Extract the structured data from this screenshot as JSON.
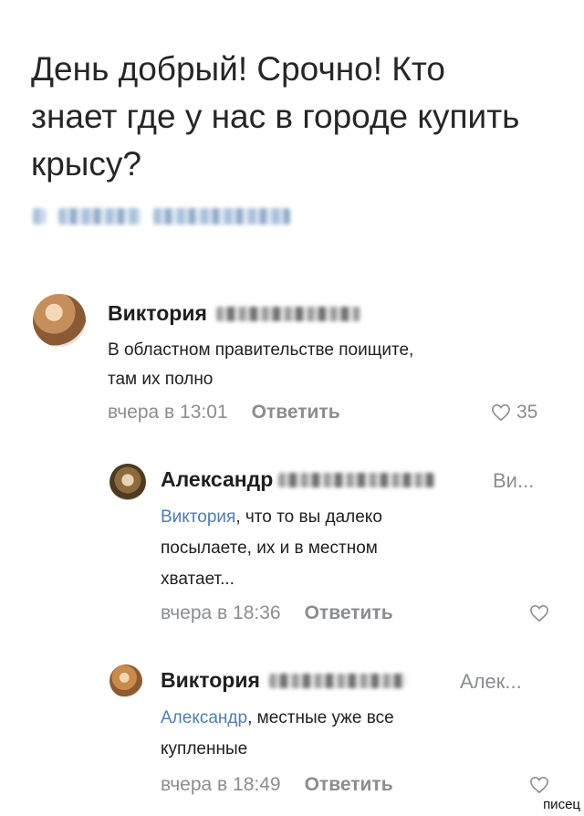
{
  "post": {
    "text_line1": "День добрый! Срочно! Кто",
    "text_line2": "знает где у нас в городе купить",
    "text_line3": "крысу?"
  },
  "comments": [
    {
      "author": "Виктория",
      "text_line1": "В областном правительстве поищите,",
      "text_line2": "там их полно",
      "time": "вчера в 13:01",
      "reply_label": "Ответить",
      "likes": "35"
    },
    {
      "author": "Александр",
      "reply_to": "Ви...",
      "mention": "Виктория",
      "text_line1_rest": ", что то вы далеко",
      "text_line2": "посылаете, их и в местном",
      "text_line3": "хватает...",
      "time": "вчера в 18:36",
      "reply_label": "Ответить"
    },
    {
      "author": "Виктория",
      "reply_to": "Алек...",
      "mention": "Александр",
      "text_line1_rest": ", местные уже все",
      "text_line2": "купленные",
      "time": "вчера в 18:49",
      "reply_label": "Ответить"
    }
  ],
  "watermark": "писец",
  "icons": {
    "like": "heart-outline-icon"
  },
  "colors": {
    "mention": "#4f7cb0",
    "meta": "#8a8d91"
  }
}
